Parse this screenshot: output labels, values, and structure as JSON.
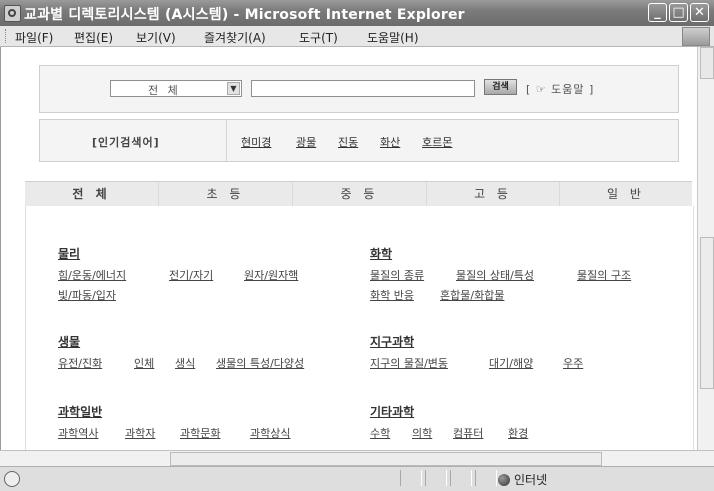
{
  "window": {
    "title": "교과별 디렉토리시스템 (A시스템) - Microsoft Internet Explorer",
    "controls": {
      "minimize": "_",
      "maximize": "□",
      "close": "✕"
    }
  },
  "menu": [
    "파일(F)",
    "편집(E)",
    "보기(V)",
    "즐겨찾기(A)",
    "도구(T)",
    "도움말(H)"
  ],
  "search": {
    "category_value": "전 체",
    "query_value": "",
    "button_label": "검색",
    "help_label": "[ ☞ 도움말 ]"
  },
  "popular": {
    "label": "[인기검색어]",
    "keywords": [
      "현미경",
      "광물",
      "진동",
      "화산",
      "호르몬"
    ]
  },
  "tabs": [
    "전 체",
    "초 등",
    "중 등",
    "고 등",
    "일 반"
  ],
  "subjects": [
    {
      "title": "물리",
      "lines": [
        [
          "힘/운동/에너지",
          "전기/자기",
          "원자/원자핵"
        ],
        [
          "빛/파동/입자"
        ]
      ]
    },
    {
      "title": "화학",
      "lines": [
        [
          "물질의 종류",
          "물질의 상태/특성",
          "물질의 구조"
        ],
        [
          "화학 반응",
          "혼합물/화합물"
        ]
      ]
    },
    {
      "title": "생물",
      "lines": [
        [
          "유전/진화",
          "인체",
          "생식",
          "생물의 특성/다양성"
        ]
      ]
    },
    {
      "title": "지구과학",
      "lines": [
        [
          "지구의 물질/변동",
          "대기/해양",
          "우주"
        ]
      ]
    },
    {
      "title": "과학일반",
      "lines": [
        [
          "과학역사",
          "과학자",
          "과학문화",
          "과학상식"
        ]
      ]
    },
    {
      "title": "기타과학",
      "lines": [
        [
          "수학",
          "의학",
          "컴퓨터",
          "환경"
        ]
      ]
    }
  ],
  "status": {
    "zone": "인터넷"
  }
}
